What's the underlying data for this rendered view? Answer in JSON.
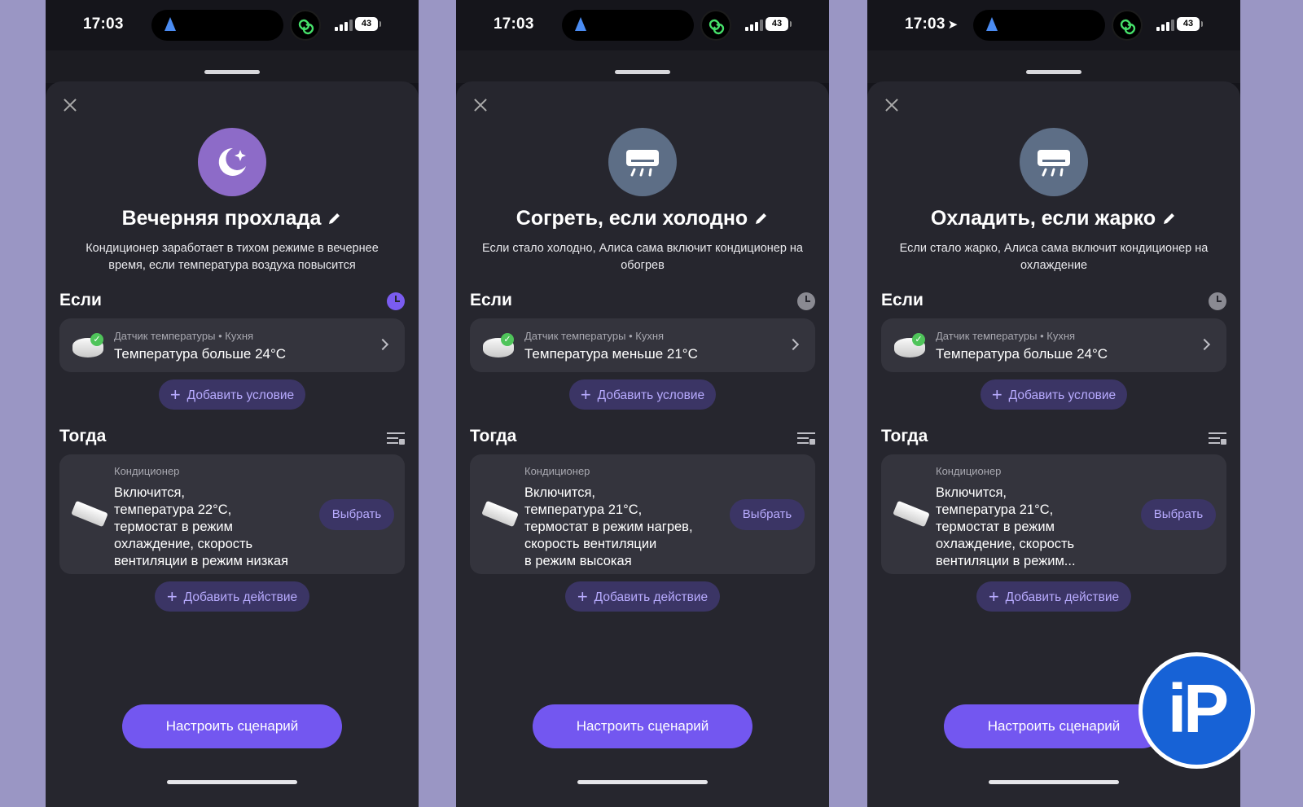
{
  "phones": [
    {
      "status": {
        "time": "17:03",
        "battery": "43",
        "show_location_arrow": false
      },
      "title": "Вечерняя прохлада",
      "description": "Кондиционер заработает в тихом режиме в вечернее время, если температура воздуха повысится",
      "icon": "moon-star-icon",
      "icon_bg": "#8d6bc8",
      "if_label": "Если",
      "clock_color": "#7a5cf0",
      "condition": {
        "caption": "Датчик температуры • Кухня",
        "text": "Температура больше 24°C"
      },
      "add_condition": "Добавить условие",
      "then_label": "Тогда",
      "action": {
        "caption": "Кондиционер",
        "lines": [
          "Включится,",
          "температура 22°C,",
          "термостат в режим",
          "охлаждение, скорость",
          "вентиляции в режим низкая"
        ],
        "select": "Выбрать"
      },
      "add_action": "Добавить действие",
      "cta": "Настроить сценарий"
    },
    {
      "status": {
        "time": "17:03",
        "battery": "43",
        "show_location_arrow": false
      },
      "title": "Согреть, если холодно",
      "description": "Если стало холодно, Алиса сама включит кондиционер на обогрев",
      "icon": "air-conditioner-icon",
      "icon_bg": "#5d6e86",
      "if_label": "Если",
      "clock_color": "#8a8a92",
      "condition": {
        "caption": "Датчик температуры • Кухня",
        "text": "Температура меньше 21°C"
      },
      "add_condition": "Добавить условие",
      "then_label": "Тогда",
      "action": {
        "caption": "Кондиционер",
        "lines": [
          "Включится,",
          "температура 21°C,",
          "термостат в режим нагрев,",
          "скорость вентиляции",
          "в режим высокая"
        ],
        "select": "Выбрать"
      },
      "add_action": "Добавить действие",
      "cta": "Настроить сценарий"
    },
    {
      "status": {
        "time": "17:03",
        "battery": "43",
        "show_location_arrow": true
      },
      "title": "Охладить, если жарко",
      "description": "Если стало жарко, Алиса сама включит кондиционер на охлаждение",
      "icon": "air-conditioner-icon",
      "icon_bg": "#5d6e86",
      "if_label": "Если",
      "clock_color": "#8a8a92",
      "condition": {
        "caption": "Датчик температуры • Кухня",
        "text": "Температура больше 24°C"
      },
      "add_condition": "Добавить условие",
      "then_label": "Тогда",
      "action": {
        "caption": "Кондиционер",
        "lines": [
          "Включится,",
          "температура 21°C,",
          "термостат в режим",
          "охлаждение, скорость",
          "вентиляции в режим..."
        ],
        "select": "Выбрать"
      },
      "add_action": "Добавить действие",
      "cta": "Настроить сценарий"
    }
  ],
  "watermark": {
    "text": "iP",
    "color": "#1762d6"
  }
}
